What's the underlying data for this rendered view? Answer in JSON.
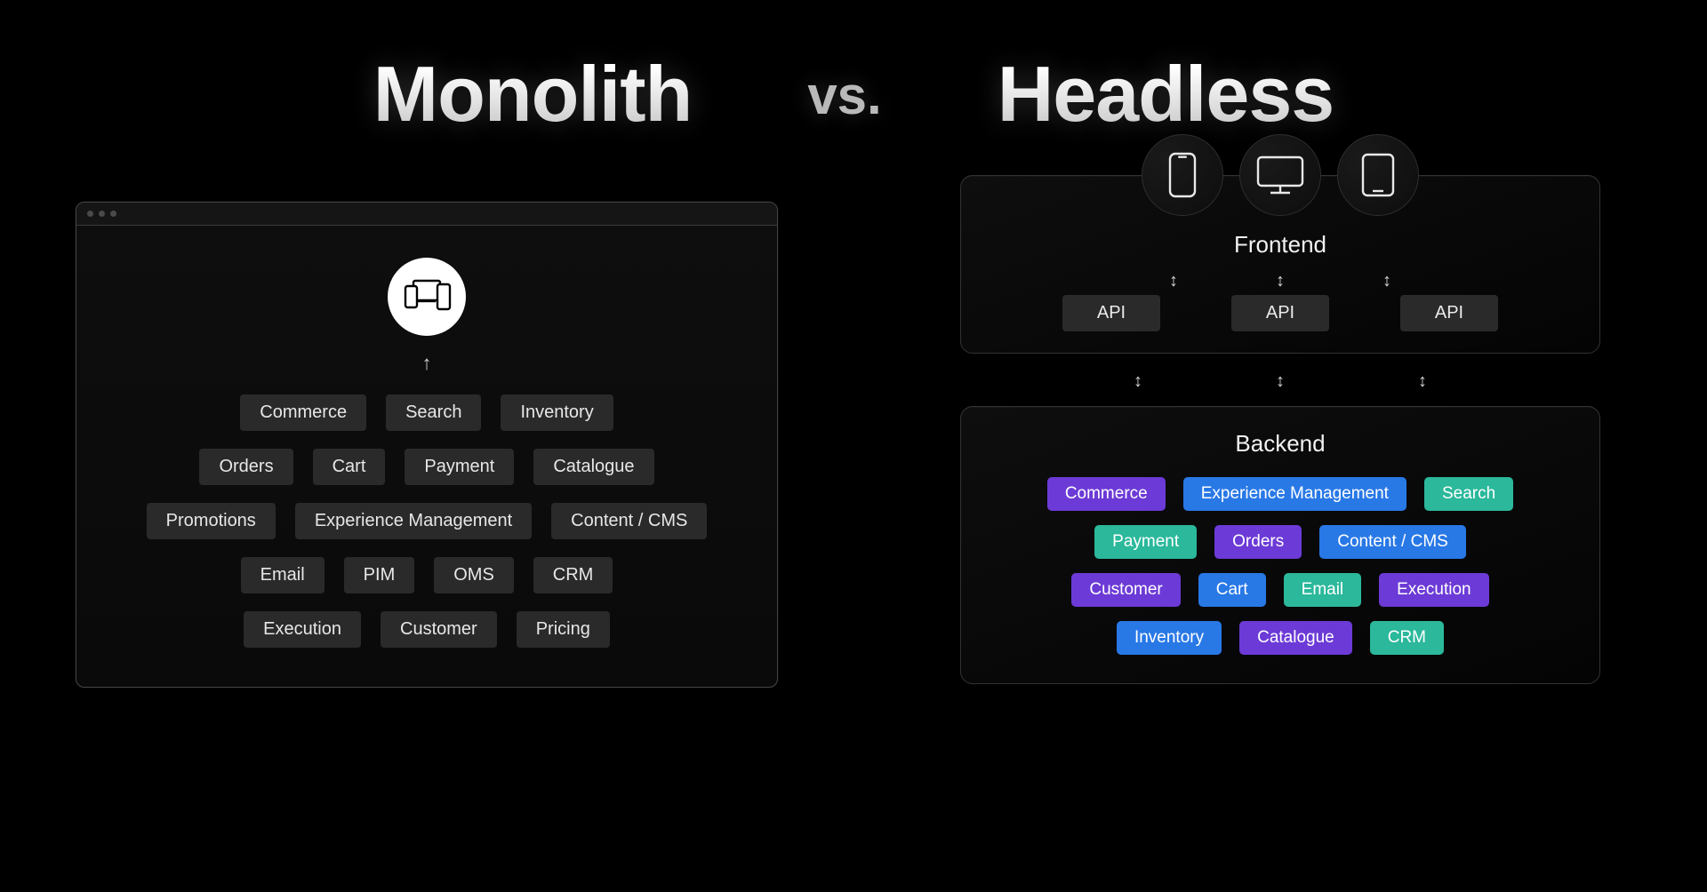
{
  "titles": {
    "left": "Monolith",
    "vs": "vs.",
    "right": "Headless"
  },
  "monolith": {
    "rows": [
      [
        "Commerce",
        "Search",
        "Inventory"
      ],
      [
        "Orders",
        "Cart",
        "Payment",
        "Catalogue"
      ],
      [
        "Promotions",
        "Experience Management",
        "Content / CMS"
      ],
      [
        "Email",
        "PIM",
        "OMS",
        "CRM"
      ],
      [
        "Execution",
        "Customer",
        "Pricing"
      ]
    ]
  },
  "headless": {
    "frontend_label": "Frontend",
    "api_label": "API",
    "backend_label": "Backend",
    "backend_rows": [
      [
        {
          "t": "Commerce",
          "c": "purple"
        },
        {
          "t": "Experience Management",
          "c": "blue"
        },
        {
          "t": "Search",
          "c": "teal"
        }
      ],
      [
        {
          "t": "Payment",
          "c": "teal"
        },
        {
          "t": "Orders",
          "c": "purple"
        },
        {
          "t": "Content / CMS",
          "c": "blue"
        }
      ],
      [
        {
          "t": "Customer",
          "c": "purple"
        },
        {
          "t": "Cart",
          "c": "blue"
        },
        {
          "t": "Email",
          "c": "teal"
        },
        {
          "t": "Execution",
          "c": "purple"
        }
      ],
      [
        {
          "t": "Inventory",
          "c": "blue"
        },
        {
          "t": "Catalogue",
          "c": "purple"
        },
        {
          "t": "CRM",
          "c": "teal"
        }
      ]
    ]
  }
}
